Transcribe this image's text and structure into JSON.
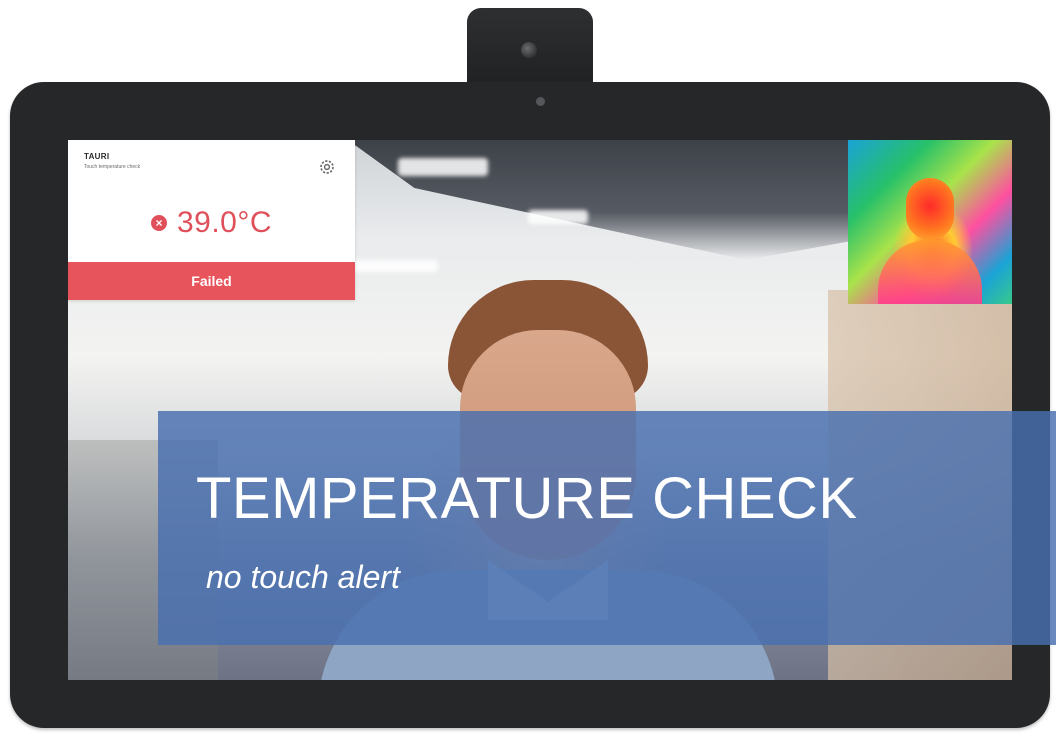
{
  "status_card": {
    "brand": "TAURI",
    "subtitle": "Touch temperature check",
    "temperature": "39.0°C",
    "status": "Failed"
  },
  "banner": {
    "title": "TEMPERATURE CHECK",
    "subtitle": "no touch alert"
  },
  "colors": {
    "alert": "#e8545c",
    "banner": "#486fb0",
    "device": "#262729"
  },
  "icons": [
    "settings-gear-icon",
    "fail-x-icon"
  ]
}
